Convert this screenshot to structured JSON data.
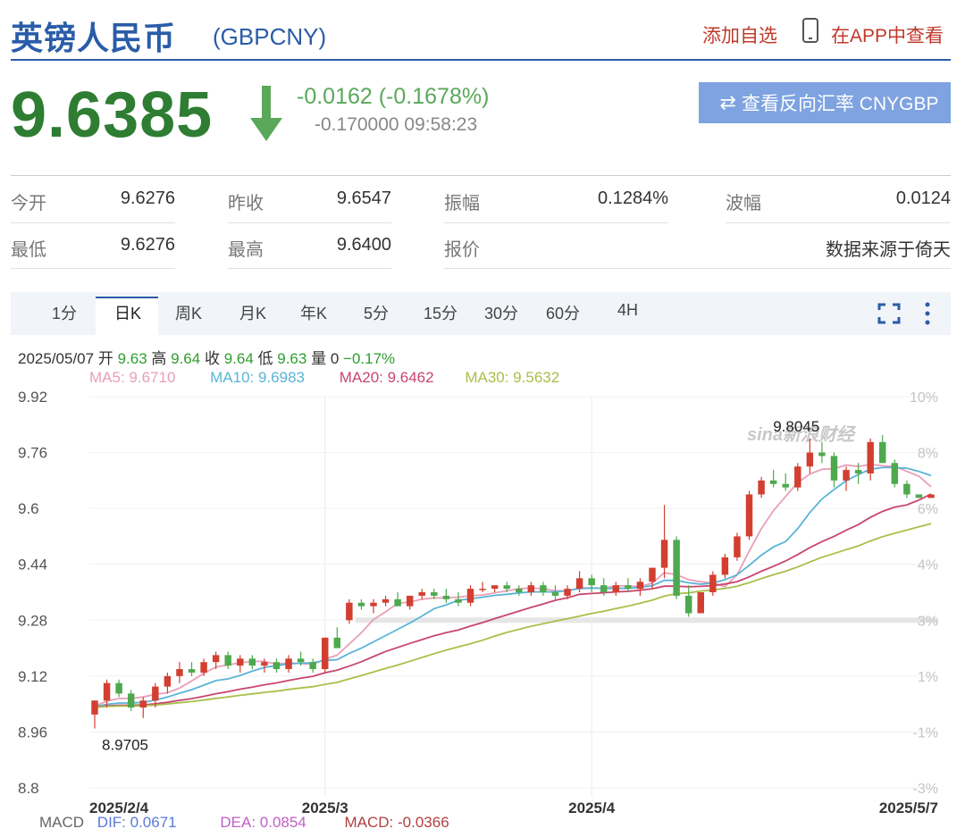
{
  "header": {
    "title": "英镑人民币",
    "code": "(GBPCNY)",
    "add_favorite": "添加自选",
    "view_in_app": "在APP中查看"
  },
  "quote": {
    "price": "9.6385",
    "change": "-0.0162 (-0.1678%)",
    "change_detail": "-0.170000 09:58:23",
    "reverse_button": "查看反向汇率 CNYGBP",
    "down_color": "#2e7d32"
  },
  "stats": {
    "open_label": "今开",
    "open_value": "9.6276",
    "prev_close_label": "昨收",
    "prev_close_value": "9.6547",
    "amplitude_label": "振幅",
    "amplitude_value": "0.1284%",
    "wave_label": "波幅",
    "wave_value": "0.0124",
    "low_label": "最低",
    "low_value": "9.6276",
    "high_label": "最高",
    "high_value": "9.6400",
    "quote_label": "报价",
    "source_text": "数据来源于倚天"
  },
  "tabs": [
    "1分",
    "日K",
    "周K",
    "月K",
    "年K",
    "5分",
    "15分",
    "30分",
    "60分",
    "4H"
  ],
  "ohlc": {
    "date": "2025/05/07",
    "open_label": "开",
    "open": "9.63",
    "high_label": "高",
    "high": "9.64",
    "close_label": "收",
    "close": "9.64",
    "low_label": "低",
    "low": "9.63",
    "vol_label": "量",
    "vol": "0",
    "pct": "−0.17%"
  },
  "ma": {
    "ma5": "MA5: 9.6710",
    "ma10": "MA10: 9.6983",
    "ma20": "MA20: 9.6462",
    "ma30": "MA30: 9.5632"
  },
  "macd": {
    "label": "MACD",
    "dif": "DIF: 0.0671",
    "dea": "DEA: 0.0854",
    "macd": "MACD: -0.0366"
  },
  "watermark": "sina新浪财经",
  "colors": {
    "up": "#d23f31",
    "down": "#4ea94e",
    "ma5": "#e8a0b8",
    "ma10": "#5ab4d6",
    "ma20": "#c8466e",
    "ma30": "#a8c04a"
  },
  "chart_data": {
    "type": "candlestick",
    "y_ticks": [
      "9.92",
      "9.76",
      "9.6",
      "9.44",
      "9.28",
      "9.12",
      "8.96",
      "8.8"
    ],
    "y_right_ticks": [
      "10%",
      "8%",
      "6%",
      "4%",
      "3%",
      "1%",
      "-1%",
      "-3%"
    ],
    "x_ticks": [
      "2025/2/4",
      "2025/3",
      "2025/4",
      "2025/5/7"
    ],
    "x_tick_index": [
      0,
      19,
      41,
      63
    ],
    "ylim": [
      8.8,
      9.92
    ],
    "annotations": [
      {
        "text": "9.8045",
        "index": 57,
        "value": 9.8045
      },
      {
        "text": "8.9705",
        "index": 0,
        "value": 8.9705
      }
    ],
    "candles": [
      [
        9.01,
        9.05,
        8.97,
        9.05
      ],
      [
        9.05,
        9.11,
        9.03,
        9.1
      ],
      [
        9.1,
        9.11,
        9.06,
        9.07
      ],
      [
        9.07,
        9.08,
        9.02,
        9.03
      ],
      [
        9.03,
        9.06,
        9.0,
        9.05
      ],
      [
        9.05,
        9.1,
        9.03,
        9.09
      ],
      [
        9.09,
        9.13,
        9.07,
        9.12
      ],
      [
        9.12,
        9.16,
        9.1,
        9.14
      ],
      [
        9.14,
        9.16,
        9.12,
        9.13
      ],
      [
        9.13,
        9.17,
        9.12,
        9.16
      ],
      [
        9.16,
        9.19,
        9.14,
        9.18
      ],
      [
        9.18,
        9.19,
        9.14,
        9.15
      ],
      [
        9.15,
        9.18,
        9.13,
        9.17
      ],
      [
        9.17,
        9.18,
        9.14,
        9.15
      ],
      [
        9.15,
        9.17,
        9.13,
        9.16
      ],
      [
        9.16,
        9.17,
        9.13,
        9.14
      ],
      [
        9.14,
        9.18,
        9.13,
        9.17
      ],
      [
        9.17,
        9.19,
        9.15,
        9.16
      ],
      [
        9.16,
        9.17,
        9.13,
        9.14
      ],
      [
        9.14,
        9.23,
        9.13,
        9.23
      ],
      [
        9.23,
        9.26,
        9.2,
        9.2
      ],
      [
        9.28,
        9.34,
        9.27,
        9.33
      ],
      [
        9.33,
        9.34,
        9.31,
        9.32
      ],
      [
        9.32,
        9.34,
        9.3,
        9.33
      ],
      [
        9.33,
        9.35,
        9.32,
        9.34
      ],
      [
        9.34,
        9.36,
        9.32,
        9.32
      ],
      [
        9.32,
        9.35,
        9.31,
        9.35
      ],
      [
        9.35,
        9.37,
        9.34,
        9.36
      ],
      [
        9.36,
        9.37,
        9.34,
        9.35
      ],
      [
        9.35,
        9.37,
        9.33,
        9.34
      ],
      [
        9.34,
        9.36,
        9.32,
        9.33
      ],
      [
        9.33,
        9.38,
        9.32,
        9.37
      ],
      [
        9.37,
        9.39,
        9.36,
        9.37
      ],
      [
        9.37,
        9.38,
        9.36,
        9.38
      ],
      [
        9.38,
        9.39,
        9.36,
        9.37
      ],
      [
        9.37,
        9.38,
        9.35,
        9.36
      ],
      [
        9.36,
        9.39,
        9.35,
        9.38
      ],
      [
        9.38,
        9.39,
        9.35,
        9.36
      ],
      [
        9.36,
        9.38,
        9.34,
        9.35
      ],
      [
        9.35,
        9.38,
        9.34,
        9.37
      ],
      [
        9.37,
        9.42,
        9.36,
        9.4
      ],
      [
        9.4,
        9.41,
        9.36,
        9.38
      ],
      [
        9.38,
        9.4,
        9.35,
        9.36
      ],
      [
        9.36,
        9.39,
        9.35,
        9.38
      ],
      [
        9.38,
        9.4,
        9.36,
        9.37
      ],
      [
        9.37,
        9.4,
        9.35,
        9.39
      ],
      [
        9.39,
        9.43,
        9.37,
        9.43
      ],
      [
        9.43,
        9.61,
        9.4,
        9.51
      ],
      [
        9.51,
        9.52,
        9.34,
        9.35
      ],
      [
        9.35,
        9.38,
        9.29,
        9.3
      ],
      [
        9.3,
        9.36,
        9.3,
        9.36
      ],
      [
        9.36,
        9.42,
        9.35,
        9.41
      ],
      [
        9.41,
        9.47,
        9.4,
        9.46
      ],
      [
        9.46,
        9.53,
        9.45,
        9.52
      ],
      [
        9.52,
        9.65,
        9.51,
        9.64
      ],
      [
        9.64,
        9.69,
        9.63,
        9.68
      ],
      [
        9.68,
        9.71,
        9.66,
        9.67
      ],
      [
        9.67,
        9.7,
        9.65,
        9.66
      ],
      [
        9.66,
        9.73,
        9.65,
        9.72
      ],
      [
        9.72,
        9.8,
        9.7,
        9.76
      ],
      [
        9.76,
        9.79,
        9.73,
        9.75
      ],
      [
        9.75,
        9.76,
        9.66,
        9.68
      ],
      [
        9.68,
        9.72,
        9.65,
        9.71
      ],
      [
        9.71,
        9.73,
        9.67,
        9.7
      ],
      [
        9.7,
        9.8,
        9.68,
        9.79
      ],
      [
        9.79,
        9.81,
        9.73,
        9.73
      ],
      [
        9.73,
        9.74,
        9.66,
        9.67
      ],
      [
        9.67,
        9.68,
        9.63,
        9.64
      ],
      [
        9.64,
        9.64,
        9.63,
        9.63
      ],
      [
        9.63,
        9.64,
        9.63,
        9.64
      ]
    ]
  }
}
